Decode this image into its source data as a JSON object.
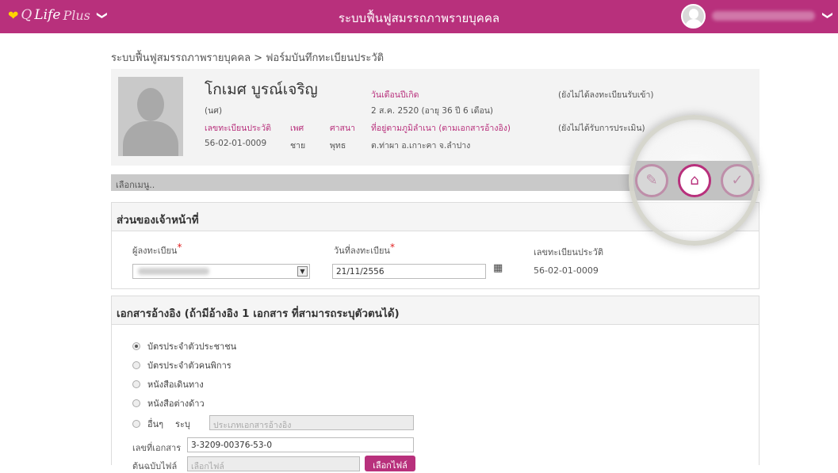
{
  "header": {
    "logo_q": "Q",
    "logo_life": "Life",
    "logo_plus": "Plus",
    "logo_chevron": "❯",
    "title": "ระบบฟื้นฟูสมรรถภาพรายบุคคล",
    "user_chevron": "❯"
  },
  "breadcrumb": "ระบบฟื้นฟูสมรรถภาพรายบุคคล > ฟอร์มบันทึกทะเบียนประวัติ",
  "profile": {
    "name": "โกเมศ บูรณ์เจริญ",
    "title_code": "(นศ)",
    "reg_label": "เลขทะเบียนประวัติ",
    "reg_value": "56-02-01-0009",
    "sex_label": "เพศ",
    "sex_value": "ชาย",
    "religion_label": "ศาสนา",
    "religion_value": "พุทธ",
    "dob_label": "วันเดือนปีเกิด",
    "dob_value": "2 ส.ค. 2520 (อายุ 36 ปี 6 เดือน)",
    "address_label": "ที่อยู่ตามภูมิลำเนา (ตามเอกสารอ้างอิง)",
    "address_value": "ต.ท่าผา อ.เกาะคา จ.ลำปาง",
    "status1": "(ยังไม่ได้ลงทะเบียนรับเข้า)",
    "status2": "(ยังไม่ได้รับการประเมิน)"
  },
  "menu_bar": {
    "label": "เลือกเมนู.."
  },
  "officer_section": {
    "title": "ส่วนของเจ้าหน้าที่",
    "registrar_label": "ผู้ลงทะเบียน",
    "required_mark": "*",
    "date_label": "วันที่ลงทะเบียน",
    "date_value": "21/11/2556",
    "reg_label": "เลขทะเบียนประวัติ",
    "reg_value": "56-02-01-0009"
  },
  "document_section": {
    "title": "เอกสารอ้างอิง (ถ้ามีอ้างอิง 1 เอกสาร ที่สามารถระบุตัวตนได้)",
    "options": [
      "บัตรประจำตัวประชาชน",
      "บัตรประจำตัวคนพิการ",
      "หนังสือเดินทาง",
      "หนังสือต่างด้าว",
      "อื่นๆ"
    ],
    "selected_index": 0,
    "specify_label": "ระบุ",
    "specify_placeholder": "ประเภทเอกสารอ้างอิง",
    "doc_no_label": "เลขที่เอกสาร",
    "doc_no_value": "3-3209-00376-53-0",
    "attach_label": "ต้นฉบับไฟล์",
    "attach_placeholder": "เลือกไฟล์",
    "choose_file_button": "เลือกไฟล์"
  },
  "toolbar_icons": {
    "edit": "✎",
    "home": "⌂",
    "check": "✓"
  },
  "colors": {
    "brand": "#b8307c",
    "bar_gray": "#c9c9c9",
    "profile_bg": "#f3f3f3"
  }
}
